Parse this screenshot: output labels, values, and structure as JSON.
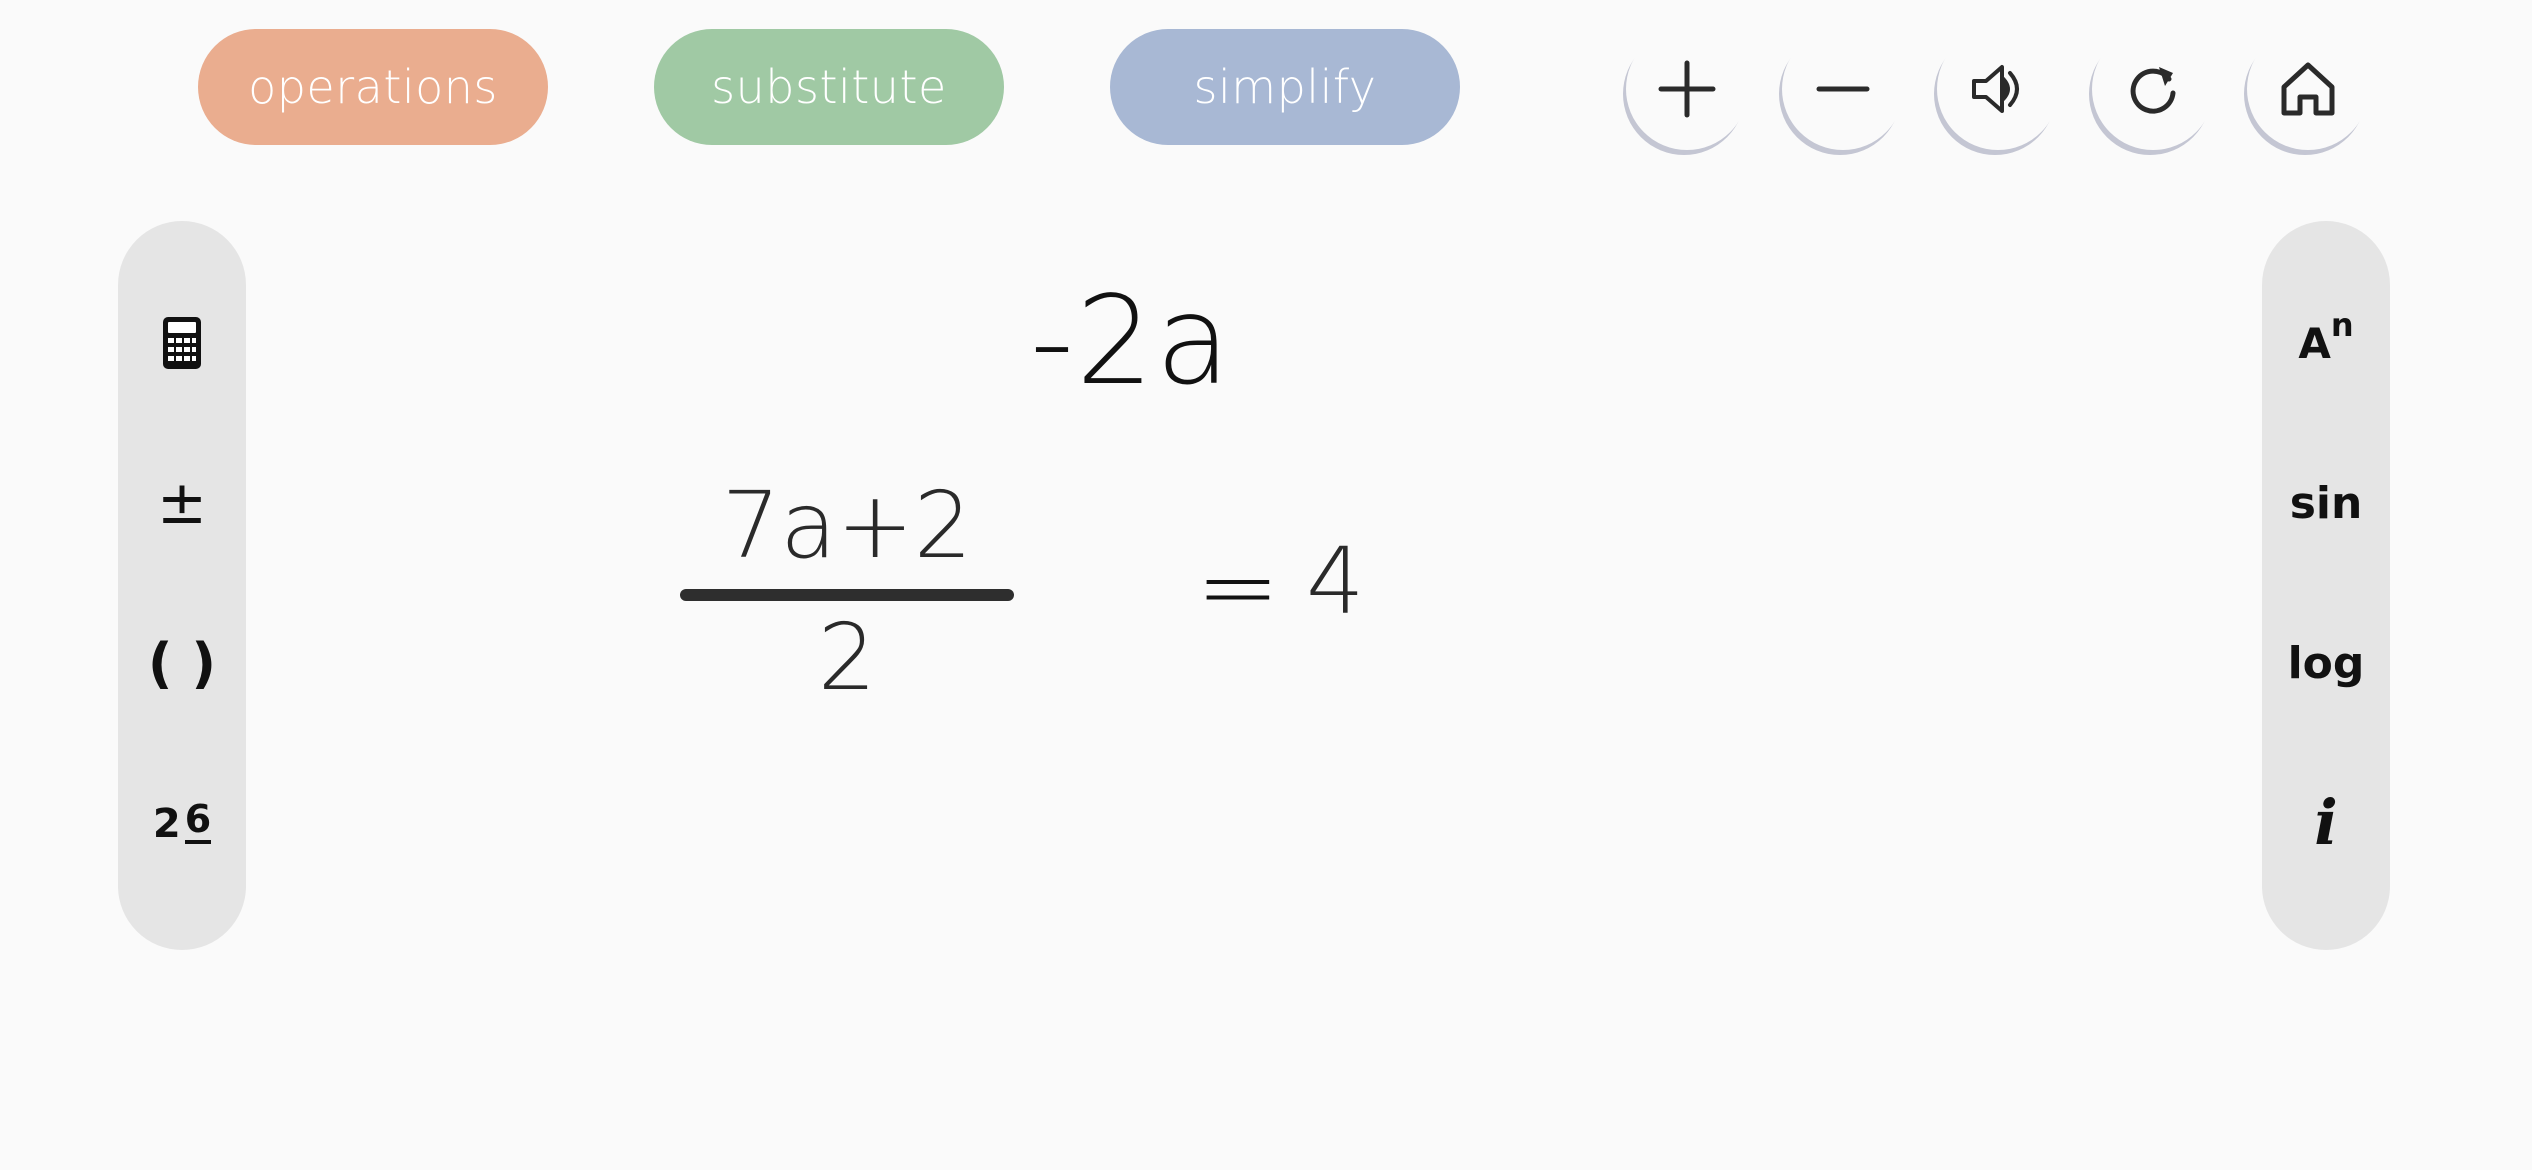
{
  "modes": {
    "operations": {
      "label": "operations",
      "color": "#eaad8f"
    },
    "substitute": {
      "label": "substitute",
      "color": "#a0c9a4"
    },
    "simplify": {
      "label": "simplify",
      "color": "#a8b8d4"
    }
  },
  "toolbar": {
    "icons": [
      "plus-icon",
      "minus-icon",
      "speaker-icon",
      "reset-icon",
      "home-icon"
    ]
  },
  "left_palette": {
    "items": [
      {
        "icon": "calculator-icon"
      },
      {
        "label": "±"
      },
      {
        "label": "( )"
      },
      {
        "label": "2",
        "fraction_top": "6"
      }
    ]
  },
  "right_palette": {
    "items": [
      {
        "base": "A",
        "exponent": "n"
      },
      {
        "label": "sin"
      },
      {
        "label": "log"
      },
      {
        "label": "i"
      }
    ]
  },
  "equation": {
    "floating_term": "-2a",
    "numerator": "7a+2",
    "denominator": "2",
    "equals": "=",
    "rhs": "4"
  }
}
